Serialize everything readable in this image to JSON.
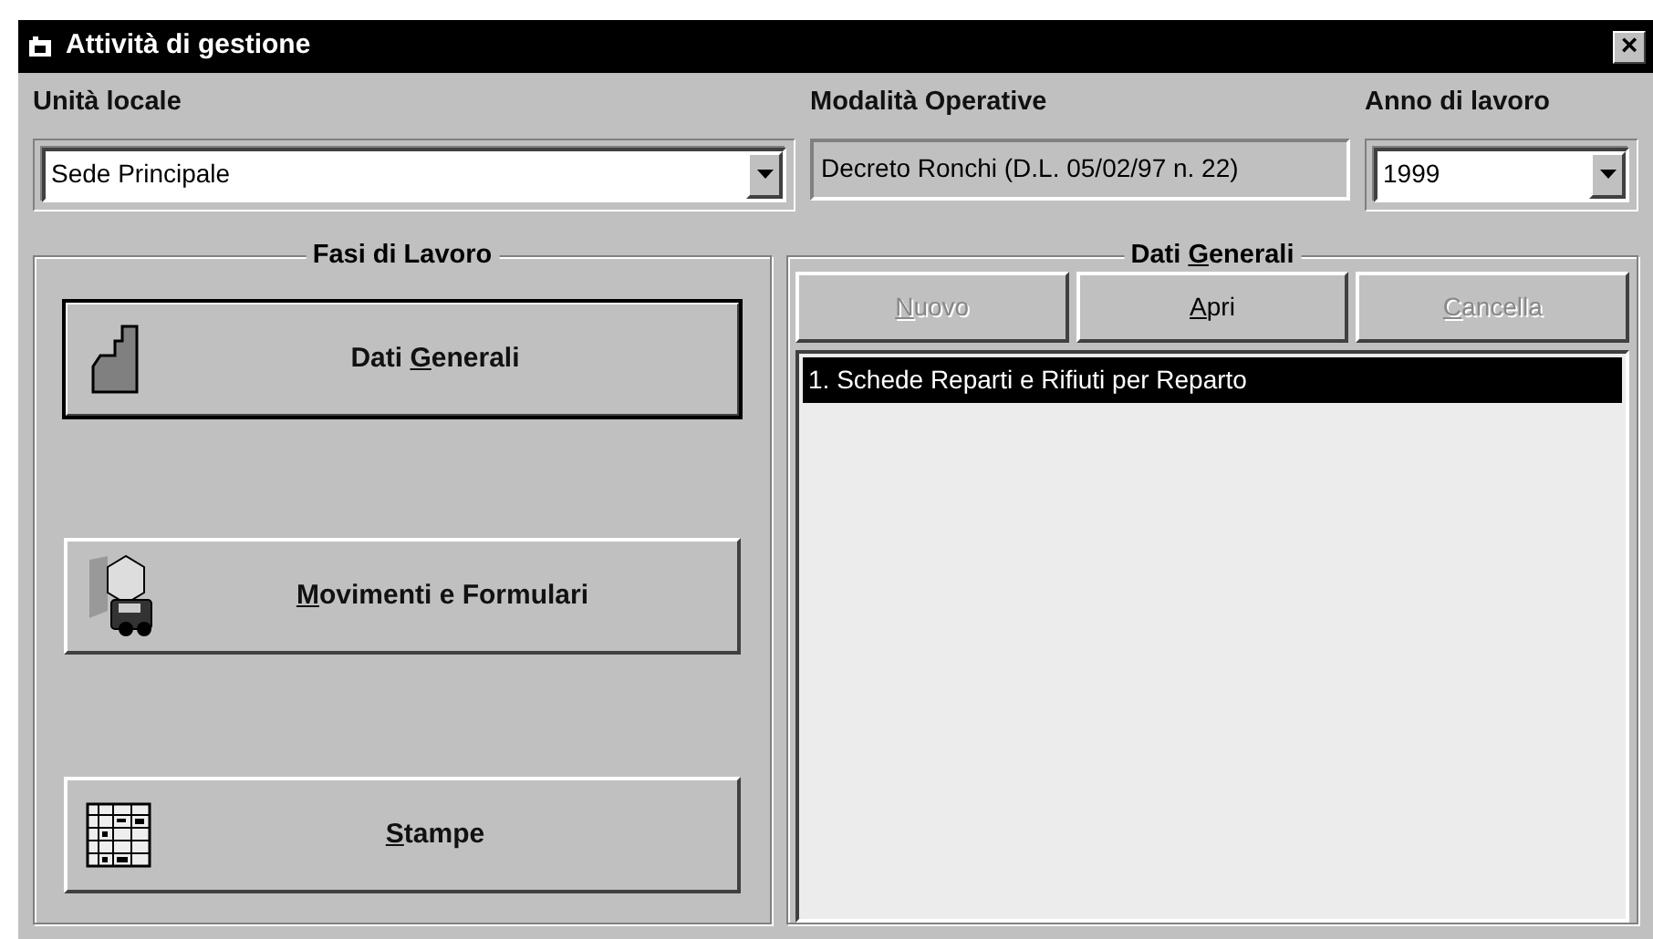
{
  "window": {
    "title": "Attività di gestione",
    "close_label": "×"
  },
  "fields": [
    {
      "label": "Unità locale",
      "kind": "combo",
      "value": "Sede Principale"
    },
    {
      "label": "Modalità Operative",
      "kind": "static",
      "value": "Decreto Ronchi (D.L. 05/02/97 n. 22)"
    },
    {
      "label": "Anno di lavoro",
      "kind": "combo",
      "value": "1999"
    }
  ],
  "phases": {
    "title": "Fasi di Lavoro",
    "buttons": [
      {
        "label": {
          "before": "Dati ",
          "key": "G",
          "after": "enerali"
        },
        "selected": true
      },
      {
        "label": {
          "key": "M",
          "after": "ovimenti e Formulari"
        },
        "selected": false
      },
      {
        "label": {
          "key": "S",
          "after": "tampe"
        },
        "selected": false
      }
    ]
  },
  "detail": {
    "title": {
      "before": "Dati ",
      "key": "G",
      "after": "enerali"
    },
    "buttons": [
      {
        "label": {
          "key": "N",
          "after": "uovo"
        },
        "disabled": true
      },
      {
        "label": {
          "key": "A",
          "after": "pri"
        },
        "disabled": false
      },
      {
        "label": {
          "key": "C",
          "after": "ancella"
        },
        "disabled": true
      }
    ],
    "items": [
      {
        "text": "1. Schede Reparti e Rifiuti per Reparto",
        "selected": true
      }
    ]
  }
}
